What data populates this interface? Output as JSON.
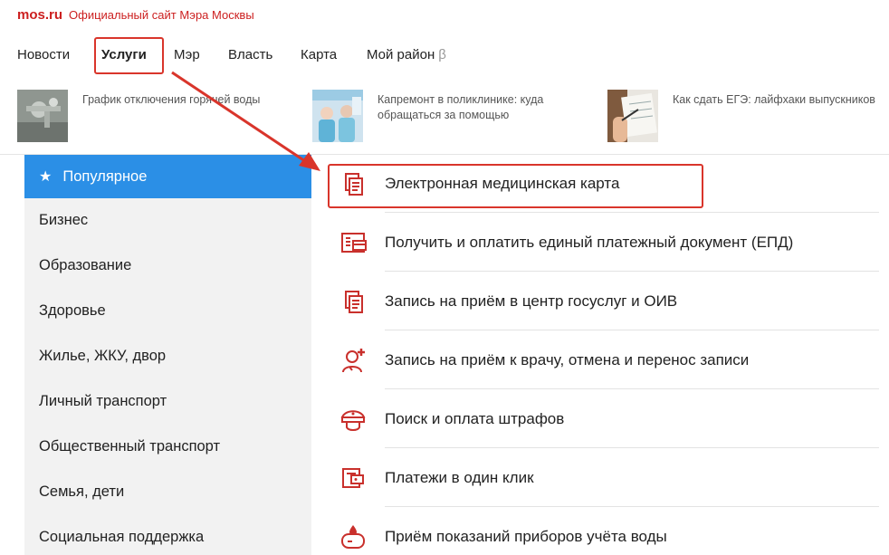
{
  "brand": {
    "logo": "mos.ru",
    "title": "Официальный сайт Мэра Москвы"
  },
  "nav": {
    "items": [
      "Новости",
      "Услуги",
      "Мэр",
      "Власть",
      "Карта",
      "Мой район"
    ],
    "beta": "β",
    "active": "Услуги"
  },
  "news": [
    {
      "text": "График отключения горячей воды",
      "icon": "faucet-photo"
    },
    {
      "text": "Капремонт в поликлинике: куда\nобращаться за помощью",
      "icon": "clinic-photo"
    },
    {
      "text": "Как сдать ЕГЭ: лайфхаки выпускников",
      "icon": "exam-photo"
    }
  ],
  "sidebar": {
    "active": "Популярное",
    "items": [
      "Бизнес",
      "Образование",
      "Здоровье",
      "Жилье, ЖКУ, двор",
      "Личный транспорт",
      "Общественный транспорт",
      "Семья, дети",
      "Социальная поддержка"
    ]
  },
  "services": [
    {
      "label": "Электронная медицинская карта",
      "icon": "document-icon"
    },
    {
      "label": "Получить и оплатить единый платежный документ (ЕПД)",
      "icon": "payment-doc-icon"
    },
    {
      "label": "Запись на приём в центр госуслуг и ОИВ",
      "icon": "document-icon"
    },
    {
      "label": "Запись на приём к врачу, отмена и перенос записи",
      "icon": "doctor-icon"
    },
    {
      "label": "Поиск и оплата штрафов",
      "icon": "police-cap-icon"
    },
    {
      "label": "Платежи в один клик",
      "icon": "wallet-icon"
    },
    {
      "label": "Приём показаний приборов учёта воды",
      "icon": "water-meter-icon"
    }
  ],
  "colors": {
    "brand": "#cc1f1f",
    "accent": "#2b8fe6",
    "highlight": "#d9352b",
    "icon": "#c9302c"
  }
}
